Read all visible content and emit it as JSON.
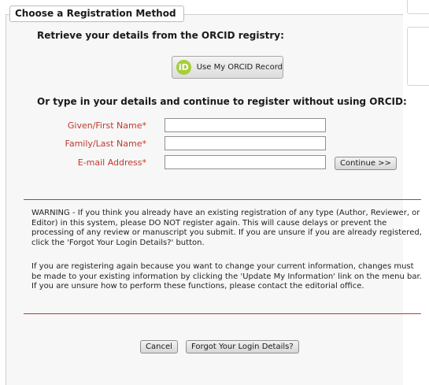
{
  "section": {
    "legend": "Choose a Registration Method"
  },
  "orcid": {
    "heading": "Retrieve your details from the ORCID registry:",
    "logo_text": "iD",
    "button_label": "Use My ORCID Record",
    "logo_color": "#a6ce39"
  },
  "manual": {
    "heading": "Or type in your details and continue to register without using ORCID:",
    "fields": [
      {
        "label": "Given/First Name*",
        "value": ""
      },
      {
        "label": "Family/Last Name*",
        "value": ""
      },
      {
        "label": "E-mail Address*",
        "value": ""
      }
    ],
    "continue_label": "Continue >>"
  },
  "notice": {
    "warning": "WARNING - If you think you already have an existing registration of any type (Author, Reviewer, or Editor) in this system, please DO NOT register again. This will cause delays or prevent the processing of any review or manuscript you submit. If you are unsure if you are already registered, click the 'Forgot Your Login Details?' button.",
    "info": "If you are registering again because you want to change your current information, changes must be made to your existing information by clicking the 'Update My Information' link on the menu bar. If you are unsure how to perform these functions, please contact the editorial office."
  },
  "actions": {
    "cancel_label": "Cancel",
    "forgot_label": "Forgot Your Login Details?"
  },
  "colors": {
    "required_label": "#c0392b",
    "divider": "#c0392b"
  }
}
